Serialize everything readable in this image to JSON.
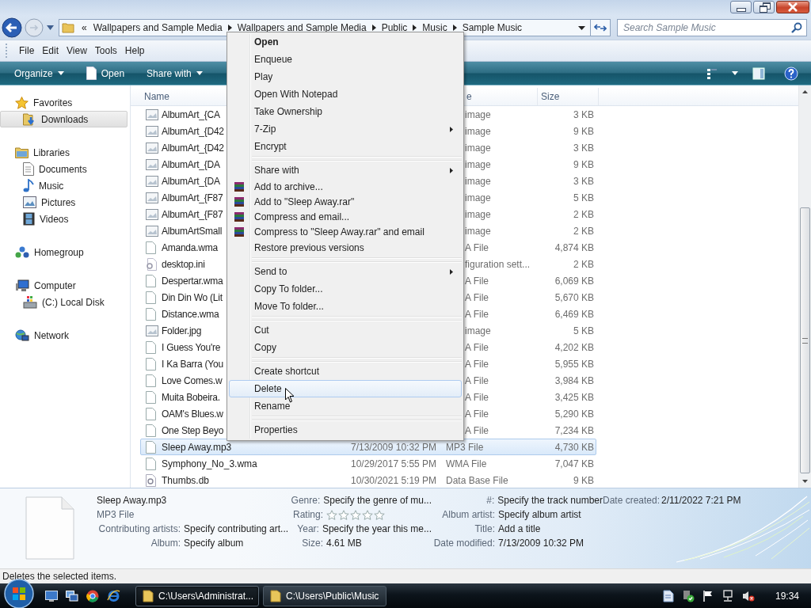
{
  "address": {
    "overflow": "«",
    "crumbs": [
      "Wallpapers and Sample Media",
      "Wallpapers and Sample Media",
      "Public",
      "Music",
      "Sample Music"
    ]
  },
  "search": {
    "placeholder": "Search Sample Music"
  },
  "menu_bar": [
    {
      "label": "File"
    },
    {
      "label": "Edit"
    },
    {
      "label": "View"
    },
    {
      "label": "Tools"
    },
    {
      "label": "Help"
    }
  ],
  "command_bar": [
    {
      "label": "Organize",
      "kind": "dropdown"
    },
    {
      "label": "Open",
      "kind": "open"
    },
    {
      "label": "Share with",
      "kind": "dropdown"
    }
  ],
  "sidebar": [
    {
      "label": "Favorites",
      "selected": false,
      "children": [
        {
          "label": "Downloads",
          "selected": true
        }
      ]
    },
    {
      "label": "Libraries",
      "selected": false,
      "children": [
        {
          "label": "Documents",
          "selected": false
        },
        {
          "label": "Music",
          "selected": false
        },
        {
          "label": "Pictures",
          "selected": false
        },
        {
          "label": "Videos",
          "selected": false
        }
      ]
    },
    {
      "label": "Homegroup",
      "selected": false
    },
    {
      "label": "Computer",
      "selected": false,
      "children": [
        {
          "label": "(C:) Local Disk",
          "selected": false
        }
      ]
    },
    {
      "label": "Network",
      "selected": false
    }
  ],
  "file_list": {
    "columns": [
      {
        "label": "Name",
        "kind": "name"
      },
      {
        "label": "e",
        "kind": "type"
      },
      {
        "label": "Size",
        "kind": "size"
      }
    ],
    "rows": [
      {
        "name": "AlbumArt_{CA",
        "type": "image",
        "size": "3 KB",
        "kind": "image",
        "selected": false
      },
      {
        "name": "AlbumArt_{D42",
        "type": "image",
        "size": "9 KB",
        "kind": "image",
        "selected": false
      },
      {
        "name": "AlbumArt_{D42",
        "type": "image",
        "size": "3 KB",
        "kind": "image",
        "selected": false
      },
      {
        "name": "AlbumArt_{DA",
        "type": "image",
        "size": "9 KB",
        "kind": "image",
        "selected": false
      },
      {
        "name": "AlbumArt_{DA",
        "type": "image",
        "size": "3 KB",
        "kind": "image",
        "selected": false
      },
      {
        "name": "AlbumArt_{F87",
        "type": "image",
        "size": "5 KB",
        "kind": "image",
        "selected": false
      },
      {
        "name": "AlbumArt_{F87",
        "type": "image",
        "size": "2 KB",
        "kind": "image",
        "selected": false
      },
      {
        "name": "AlbumArtSmall",
        "type": "image",
        "size": "2 KB",
        "kind": "image",
        "selected": false
      },
      {
        "name": "Amanda.wma",
        "type": "A File",
        "size": "4,874 KB",
        "kind": "file",
        "selected": false
      },
      {
        "name": "desktop.ini",
        "type": "figuration sett...",
        "size": "2 KB",
        "kind": "settings",
        "selected": false
      },
      {
        "name": "Despertar.wma",
        "type": "A File",
        "size": "6,069 KB",
        "kind": "file",
        "selected": false
      },
      {
        "name": "Din Din Wo (Lit",
        "type": "A File",
        "size": "5,670 KB",
        "kind": "file",
        "selected": false
      },
      {
        "name": "Distance.wma",
        "type": "A File",
        "size": "6,469 KB",
        "kind": "file",
        "selected": false
      },
      {
        "name": "Folder.jpg",
        "type": "image",
        "size": "5 KB",
        "kind": "image",
        "selected": false
      },
      {
        "name": "I Guess You're",
        "type": "A File",
        "size": "4,202 KB",
        "kind": "file",
        "selected": false
      },
      {
        "name": "I Ka Barra (You",
        "type": "A File",
        "size": "5,955 KB",
        "kind": "file",
        "selected": false
      },
      {
        "name": "Love Comes.w",
        "type": "A File",
        "size": "3,984 KB",
        "kind": "file",
        "selected": false
      },
      {
        "name": "Muita Bobeira.",
        "type": "A File",
        "size": "3,425 KB",
        "kind": "file",
        "selected": false
      },
      {
        "name": "OAM's Blues.w",
        "type": "A File",
        "size": "5,290 KB",
        "kind": "file",
        "selected": false
      },
      {
        "name": "One Step Beyo",
        "type": "A File",
        "size": "7,234 KB",
        "kind": "file",
        "selected": false
      },
      {
        "name": "Sleep Away.mp3",
        "date": "7/13/2009 10:32 PM",
        "type": "MP3 File",
        "size": "4,730 KB",
        "kind": "file",
        "selected": true
      },
      {
        "name": "Symphony_No_3.wma",
        "date": "10/29/2017 5:55 PM",
        "type": "WMA File",
        "size": "7,047 KB",
        "kind": "file",
        "selected": false
      },
      {
        "name": "Thumbs.db",
        "date": "10/30/2021 5:19 PM",
        "type": "Data Base File",
        "size": "9 KB",
        "kind": "database",
        "selected": false
      }
    ]
  },
  "context_menu": [
    {
      "kind": "command",
      "label": "Open",
      "default": true,
      "submenu": false,
      "selected": false
    },
    {
      "kind": "command",
      "label": "Enqueue",
      "default": false,
      "submenu": false,
      "selected": false
    },
    {
      "kind": "command",
      "label": "Play",
      "default": false,
      "submenu": false,
      "selected": false
    },
    {
      "kind": "command",
      "label": "Open With Notepad",
      "default": false,
      "submenu": false,
      "selected": false
    },
    {
      "kind": "command",
      "label": "Take Ownership",
      "default": false,
      "submenu": false,
      "selected": false
    },
    {
      "kind": "command",
      "label": "7-Zip",
      "default": false,
      "submenu": true,
      "selected": false
    },
    {
      "kind": "command",
      "label": "Encrypt",
      "default": false,
      "submenu": false,
      "selected": false
    },
    {
      "kind": "separator"
    },
    {
      "kind": "command",
      "label": "Share with",
      "default": false,
      "submenu": true,
      "selected": false
    },
    {
      "kind": "archive",
      "label": "Add to archive...",
      "default": false,
      "submenu": false,
      "selected": false
    },
    {
      "kind": "archive",
      "label": "Add to \"Sleep Away.rar\"",
      "default": false,
      "submenu": false,
      "selected": false
    },
    {
      "kind": "archive",
      "label": "Compress and email...",
      "default": false,
      "submenu": false,
      "selected": false
    },
    {
      "kind": "archive",
      "label": "Compress to \"Sleep Away.rar\" and email",
      "default": false,
      "submenu": false,
      "selected": false
    },
    {
      "kind": "command",
      "label": "Restore previous versions",
      "default": false,
      "submenu": false,
      "selected": false
    },
    {
      "kind": "separator"
    },
    {
      "kind": "command",
      "label": "Send to",
      "default": false,
      "submenu": true,
      "selected": false
    },
    {
      "kind": "command",
      "label": "Copy To folder...",
      "default": false,
      "submenu": false,
      "selected": false
    },
    {
      "kind": "command",
      "label": "Move To folder...",
      "default": false,
      "submenu": false,
      "selected": false
    },
    {
      "kind": "separator"
    },
    {
      "kind": "command",
      "label": "Cut",
      "default": false,
      "submenu": false,
      "selected": false
    },
    {
      "kind": "command",
      "label": "Copy",
      "default": false,
      "submenu": false,
      "selected": false
    },
    {
      "kind": "separator"
    },
    {
      "kind": "command",
      "label": "Create shortcut",
      "default": false,
      "submenu": false,
      "selected": false
    },
    {
      "kind": "command",
      "label": "Delete",
      "default": false,
      "submenu": false,
      "selected": true
    },
    {
      "kind": "command",
      "label": "Rename",
      "default": false,
      "submenu": false,
      "selected": false
    },
    {
      "kind": "separator"
    },
    {
      "kind": "command",
      "label": "Properties",
      "default": false,
      "submenu": false,
      "selected": false
    }
  ],
  "details": {
    "name": "Sleep Away.mp3",
    "type": "MP3 File",
    "columns": [
      [
        {
          "label": "Contributing artists:",
          "value": "Specify contributing art...",
          "kind": "text"
        },
        {
          "label": "Album:",
          "value": "Specify album",
          "kind": "text"
        }
      ],
      [
        {
          "label": "Genre:",
          "value": "Specify the genre of mu...",
          "kind": "text"
        },
        {
          "label": "Rating:",
          "kind": "rating",
          "stars": 0
        },
        {
          "label": "Year:",
          "value": "Specify the year this me...",
          "kind": "text"
        },
        {
          "label": "Size:",
          "value": "4.61 MB",
          "kind": "text"
        }
      ],
      [
        {
          "label": "#:",
          "value": "Specify the track number",
          "kind": "text"
        },
        {
          "label": "Album artist:",
          "value": "Specify album artist",
          "kind": "text"
        },
        {
          "label": "Title:",
          "value": "Add a title",
          "kind": "text"
        },
        {
          "label": "Date modified:",
          "value": "7/13/2009 10:32 PM",
          "kind": "text"
        }
      ],
      [
        {
          "label": "Date created:",
          "value": "2/11/2022 7:21 PM",
          "kind": "text"
        }
      ]
    ]
  },
  "status_bar": {
    "text": "Deletes the selected items."
  },
  "taskbar": {
    "tasks": [
      {
        "label": "C:\\Users\\Administrat...",
        "selected": true
      },
      {
        "label": "C:\\Users\\Public\\Music",
        "selected": false
      }
    ],
    "clock": "19:34"
  }
}
